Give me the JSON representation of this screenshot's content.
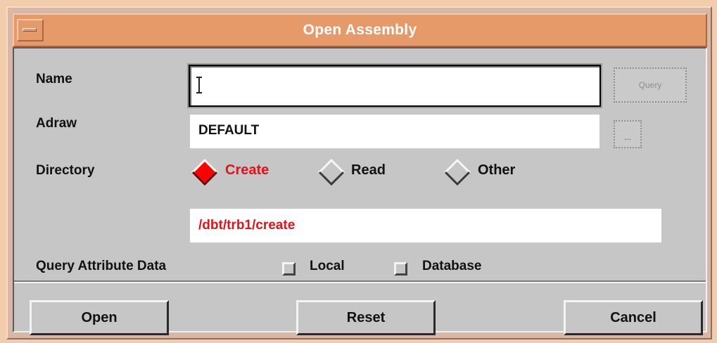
{
  "window": {
    "title": "Open Assembly"
  },
  "form": {
    "name": {
      "label": "Name",
      "value": ""
    },
    "query_button": {
      "label": "Query"
    },
    "adraw": {
      "label": "Adraw",
      "value": "DEFAULT"
    },
    "ellipsis_button": {
      "label": "..."
    },
    "directory": {
      "label": "Directory",
      "options": [
        {
          "label": "Create",
          "selected": true
        },
        {
          "label": "Read",
          "selected": false
        },
        {
          "label": "Other",
          "selected": false
        }
      ],
      "path": "/dbt/trb1/create"
    },
    "query_attr": {
      "label": "Query Attribute Data",
      "options": [
        {
          "label": "Local",
          "checked": false
        },
        {
          "label": "Database",
          "checked": false
        }
      ]
    }
  },
  "buttons": {
    "open": "Open",
    "reset": "Reset",
    "cancel": "Cancel"
  },
  "colors": {
    "title_bar": "#e79a69",
    "dialog_bg": "#c6c6c6",
    "accent_red": "#e0141a",
    "selected_radio": "#ff0000"
  }
}
